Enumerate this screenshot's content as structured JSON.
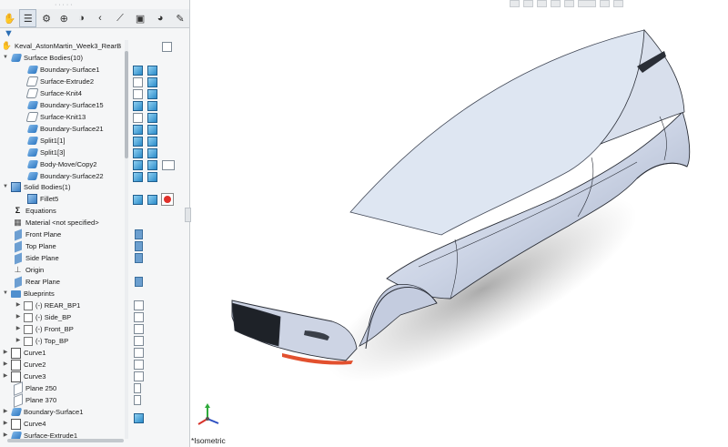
{
  "tree": {
    "part": "Keval_AstonMartin_Week3_RearB",
    "surface_bodies": "Surface Bodies(10)",
    "surface_items": [
      {
        "label": "Boundary-Surface1",
        "icon": "boundary-surface-icon"
      },
      {
        "label": "Surface-Extrude2",
        "icon": "surface-extrude-icon"
      },
      {
        "label": "Surface-Knit4",
        "icon": "surface-knit-icon"
      },
      {
        "label": "Boundary-Surface15",
        "icon": "boundary-surface-icon"
      },
      {
        "label": "Surface-Knit13",
        "icon": "surface-knit-icon"
      },
      {
        "label": "Boundary-Surface21",
        "icon": "boundary-surface-icon"
      },
      {
        "label": "Split1[1]",
        "icon": "split-icon"
      },
      {
        "label": "Split1[3]",
        "icon": "split-icon"
      },
      {
        "label": "Body-Move/Copy2",
        "icon": "move-copy-icon"
      },
      {
        "label": "Boundary-Surface22",
        "icon": "boundary-surface-icon"
      }
    ],
    "solid_bodies": "Solid Bodies(1)",
    "solid_item": "Fillet5",
    "equations": "Equations",
    "material": "Material <not specified>",
    "planes": [
      "Front Plane",
      "Top Plane",
      "Side Plane"
    ],
    "origin": "Origin",
    "rear_plane": "Rear Plane",
    "blueprints": "Blueprints",
    "blueprint_items": [
      "(-) REAR_BP1",
      "(-) Side_BP",
      "(-) Front_BP",
      "(-) Top_BP"
    ],
    "features": [
      {
        "label": "Curve1",
        "icon": "curve-icon"
      },
      {
        "label": "Curve2",
        "icon": "curve-icon"
      },
      {
        "label": "Curve3",
        "icon": "curve-icon"
      },
      {
        "label": "Plane 250",
        "icon": "plane-icon"
      },
      {
        "label": "Plane 370",
        "icon": "plane-icon"
      },
      {
        "label": "Boundary-Surface1",
        "icon": "boundary-surface-icon"
      },
      {
        "label": "Curve4",
        "icon": "curve-icon"
      },
      {
        "label": "Surface-Extrude1",
        "icon": "surface-extrude-icon"
      }
    ]
  },
  "viewport": {
    "view_name": "*Isometric",
    "colors": {
      "body": "#c9d2e6",
      "outline": "#2b2f38",
      "glass": "#1e2228",
      "accent": "#e2502e"
    }
  }
}
